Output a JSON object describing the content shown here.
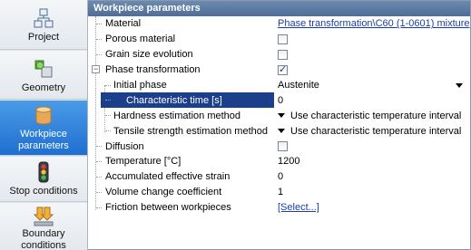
{
  "sidebar": {
    "items": [
      {
        "label": "Project",
        "icon": "project-icon"
      },
      {
        "label": "Geometry",
        "icon": "geometry-icon"
      },
      {
        "label_line1": "Workpiece",
        "label_line2": "parameters",
        "icon": "workpiece-icon",
        "active": true
      },
      {
        "label": "Stop conditions",
        "icon": "traffic-light-icon"
      },
      {
        "label_line1": "Boundary",
        "label_line2": "conditions",
        "icon": "boundary-icon"
      }
    ]
  },
  "panel": {
    "title": "Workpiece parameters"
  },
  "rows": {
    "material": {
      "name": "Material",
      "value": "Phase transformation\\C60 (1-0601) mixture"
    },
    "porous": {
      "name": "Porous material",
      "checked": false
    },
    "grain": {
      "name": "Grain size evolution",
      "checked": false
    },
    "phase": {
      "name": "Phase transformation",
      "checked": true
    },
    "initial_phase": {
      "name": "Initial phase",
      "value": "Austenite"
    },
    "char_time": {
      "name": "Characteristic time [s]",
      "value": "0"
    },
    "hardness": {
      "name": "Hardness estimation method",
      "value": "Use characteristic temperature interval"
    },
    "tensile": {
      "name": "Tensile strength estimation method",
      "value": "Use characteristic temperature interval"
    },
    "diffusion": {
      "name": "Diffusion",
      "checked": false
    },
    "temperature": {
      "name": "Temperature [°C]",
      "value": "1200"
    },
    "strain": {
      "name": "Accumulated effective strain",
      "value": "0"
    },
    "volume": {
      "name": "Volume change coefficient",
      "value": "1"
    },
    "friction": {
      "name": "Friction between workpieces",
      "value": "[Select...]"
    }
  },
  "colors": {
    "title_bar": "#5a789f",
    "active_nav": "#2e7fd9",
    "selected_row": "#1c3f8c",
    "link": "#1a3ea8"
  }
}
